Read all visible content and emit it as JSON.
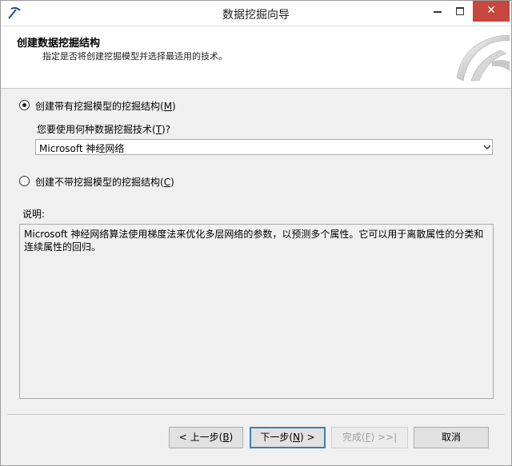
{
  "window": {
    "title": "数据挖掘向导"
  },
  "header": {
    "title": "创建数据挖掘结构",
    "subtitle": "指定是否将创建挖掘模型并选择最适用的技术。"
  },
  "options": {
    "with_model": {
      "label": "创建带有挖掘模型的挖掘结构(",
      "key": "M",
      "suffix": ")",
      "selected": true
    },
    "question": {
      "label": "您要使用何种数据挖掘技术(",
      "key": "T",
      "suffix": ")?"
    },
    "technique": {
      "selected": "Microsoft 神经网络"
    },
    "without_model": {
      "label": "创建不带挖掘模型的挖掘结构(",
      "key": "C",
      "suffix": ")",
      "selected": false
    }
  },
  "description": {
    "label": "说明:",
    "text": "Microsoft 神经网络算法使用梯度法来优化多层网络的参数，以预测多个属性。它可以用于离散属性的分类和连续属性的回归。"
  },
  "buttons": {
    "prev": {
      "prefix": "< 上一步(",
      "key": "B",
      "suffix": ")"
    },
    "next": {
      "prefix": "下一步(",
      "key": "N",
      "suffix": ") >"
    },
    "finish": {
      "prefix": "完成(",
      "key": "F",
      "suffix": ") >>|"
    },
    "cancel": {
      "label": "取消"
    }
  },
  "icons": {
    "app": "wizard-icon",
    "minimize": "minimize-icon",
    "maximize": "maximize-icon",
    "close": "close-icon",
    "dropdown": "chevron-down-icon"
  },
  "colors": {
    "close_button": "#c7463e",
    "default_button_border": "#3c7fb1"
  }
}
